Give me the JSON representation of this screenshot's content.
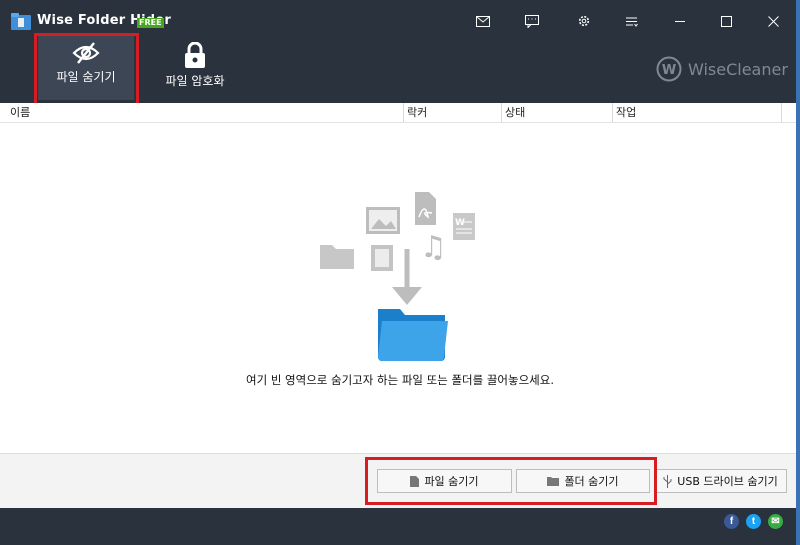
{
  "app": {
    "title": "Wise Folder Hider",
    "badge": "FREE"
  },
  "toolbar": {
    "hide_file_label": "파일 숨기기",
    "encrypt_file_label": "파일 암호화"
  },
  "brand": {
    "name": "WiseCleaner",
    "logo_letter": "W"
  },
  "table": {
    "columns": [
      "이름",
      "락커",
      "상태",
      "작업"
    ]
  },
  "dropzone": {
    "hint": "여기 빈 영역으로 숨기고자 하는 파일 또는 폴더를 끌어놓으세요."
  },
  "actions": {
    "hide_file": "파일 숨기기",
    "hide_folder": "폴더 숨기기",
    "usb_hide": "USB 드라이브 숨기기"
  },
  "social": {
    "facebook": "f",
    "twitter": "t",
    "email": "✉"
  },
  "colors": {
    "titlebar": "#2a323d",
    "highlight": "#d81c24",
    "free_badge": "#45a81d"
  }
}
